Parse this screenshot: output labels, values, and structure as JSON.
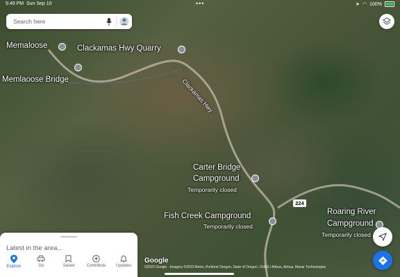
{
  "status": {
    "time": "5:49 PM",
    "date": "Sun Sep 10",
    "battery": "100%"
  },
  "search": {
    "placeholder": "Search here"
  },
  "labels": {
    "memaloose": "Memaloose",
    "quarry": "Clackamas Hwy Quarry",
    "bridge": "Memlaoose Bridge",
    "hwy": "Clackamas Hwy",
    "carter_line1": "Carter Bridge",
    "carter_line2": "Campground",
    "carter_status": "Temporarily closed",
    "fish": "Fish Creek Campground",
    "fish_status": "Temporarily closed",
    "roaring_line1": "Roaring River",
    "roaring_line2": "Campground",
    "roaring_status": "Temporarily closed",
    "route_shield": "224"
  },
  "sheet": {
    "latest": "Latest in the area..."
  },
  "tabs": [
    {
      "label": "Explore",
      "icon": "explore-pin-icon",
      "active": true
    },
    {
      "label": "Go",
      "icon": "car-icon",
      "active": false
    },
    {
      "label": "Saved",
      "icon": "bookmark-icon",
      "active": false
    },
    {
      "label": "Contribute",
      "icon": "plus-circle-icon",
      "active": false
    },
    {
      "label": "Updates",
      "icon": "bell-icon",
      "active": false
    }
  ],
  "map": {
    "logo": "Google",
    "attribution": "©2023 Google · Imagery ©2023 Metro, Portland Oregon, State of Oregon, CNES / Airbus, Airbus, Maxar Technologies"
  },
  "colors": {
    "accent": "#1a73e8"
  }
}
